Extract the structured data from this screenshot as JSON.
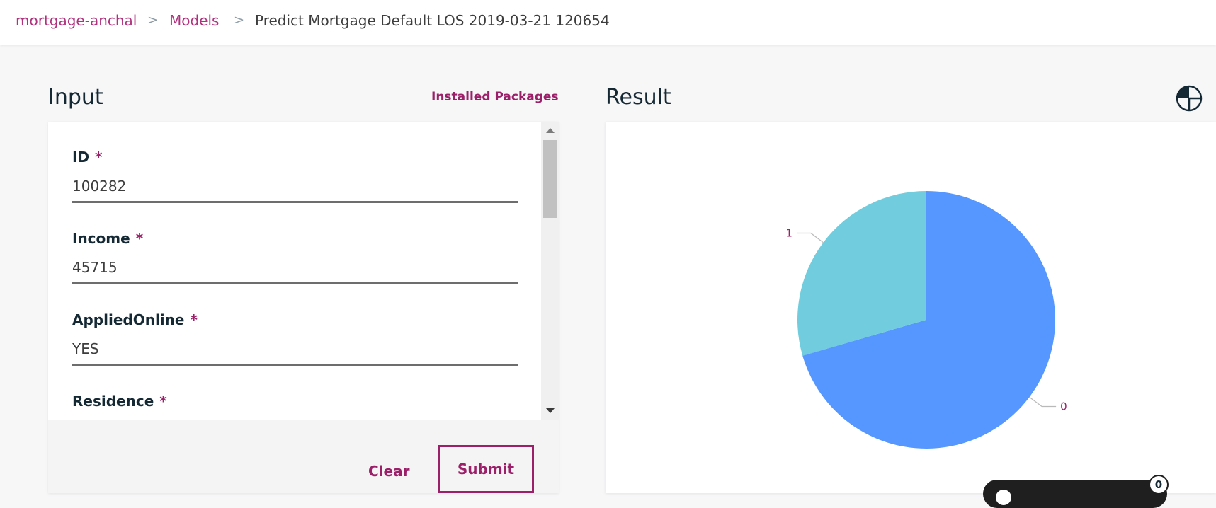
{
  "breadcrumb": {
    "project": "mortgage-anchal",
    "section": "Models",
    "current": "Predict Mortgage Default LOS 2019-03-21 120654",
    "separator": ">"
  },
  "input": {
    "title": "Input",
    "installed_packages": "Installed Packages",
    "required_mark": "*",
    "fields": [
      {
        "label": "ID",
        "value": "100282"
      },
      {
        "label": "Income",
        "value": "45715"
      },
      {
        "label": "AppliedOnline",
        "value": "YES"
      },
      {
        "label": "Residence",
        "value": ""
      }
    ],
    "clear_label": "Clear",
    "submit_label": "Submit"
  },
  "result": {
    "title": "Result",
    "toggle_icon": "pie-chart-icon"
  },
  "chart_data": {
    "type": "pie",
    "slices": [
      {
        "label": "0",
        "value": 0.705,
        "color": "#5596ff"
      },
      {
        "label": "1",
        "value": 0.295,
        "color": "#71cddd"
      }
    ]
  },
  "notification": {
    "count": "0"
  },
  "colors": {
    "brand": "#9b1f69",
    "link": "#b0327f"
  }
}
